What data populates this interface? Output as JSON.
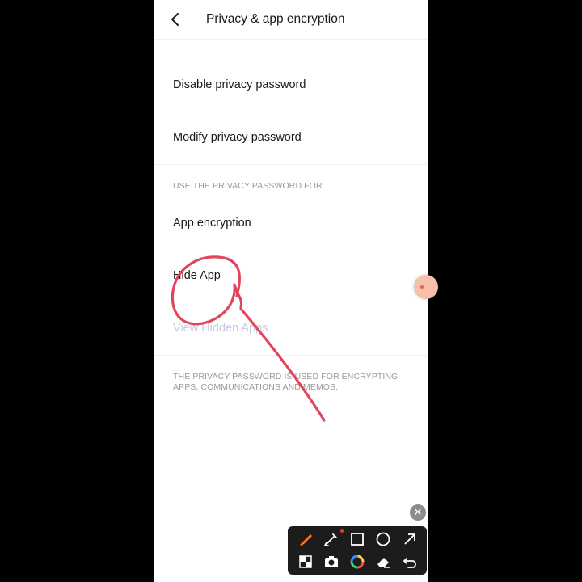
{
  "header": {
    "title": "Privacy & app encryption",
    "back_icon": "chevron-left-icon"
  },
  "password": {
    "disable_label": "Disable privacy password",
    "modify_label": "Modify privacy password"
  },
  "section": {
    "heading": "USE THE PRIVACY PASSWORD FOR",
    "items": [
      {
        "label": "App encryption"
      },
      {
        "label": "Hide App"
      },
      {
        "label": "View Hidden Apps"
      }
    ]
  },
  "footer_note": "THE PRIVACY PASSWORD IS USED FOR ENCRYPTING APPS, COMMUNICATIONS AND MEMOS.",
  "overlay": {
    "annotation_color": "#e0455c",
    "close_icon_glyph": "✕",
    "toolbar": {
      "tools": [
        "brush-icon",
        "highlighter-icon",
        "rectangle-icon",
        "circle-icon",
        "arrow-icon",
        "mosaic-icon",
        "camera-icon",
        "color-wheel-icon",
        "eraser-icon",
        "undo-icon"
      ]
    }
  }
}
